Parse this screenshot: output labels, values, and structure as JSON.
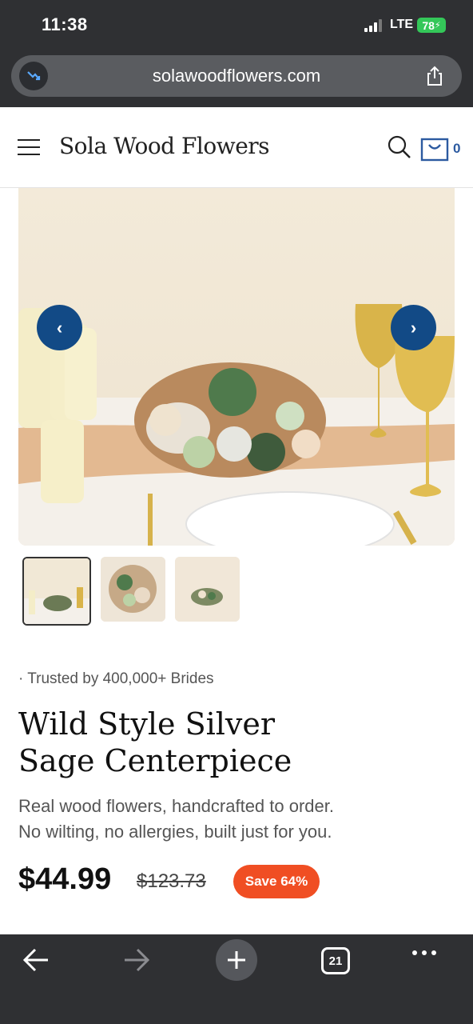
{
  "status_bar": {
    "time": "11:38",
    "network": "LTE",
    "battery": "78"
  },
  "browser": {
    "url": "solawoodflowers.com"
  },
  "site_header": {
    "logo": "Sola Wood Flowers",
    "cart_count": "0"
  },
  "product": {
    "trusted": "· Trusted by 400,000+ Brides",
    "title_line1": "Wild Style Silver",
    "title_line2": "Sage Centerpiece",
    "desc_line1": "Real wood flowers, handcrafted to order.",
    "desc_line2": "No wilting, no allergies, built just for you.",
    "price": "$44.99",
    "old_price": "$123.73",
    "save_badge": "Save 64%"
  },
  "carousel": {
    "prev_icon": "chevron-left-icon",
    "next_icon": "chevron-right-icon",
    "thumbnails": 3,
    "active_thumbnail": 1
  },
  "toolbar": {
    "tabs_count": "21"
  },
  "colors": {
    "accent_blue": "#124a86",
    "save_orange": "#f04e23",
    "chrome": "#2f3033"
  }
}
